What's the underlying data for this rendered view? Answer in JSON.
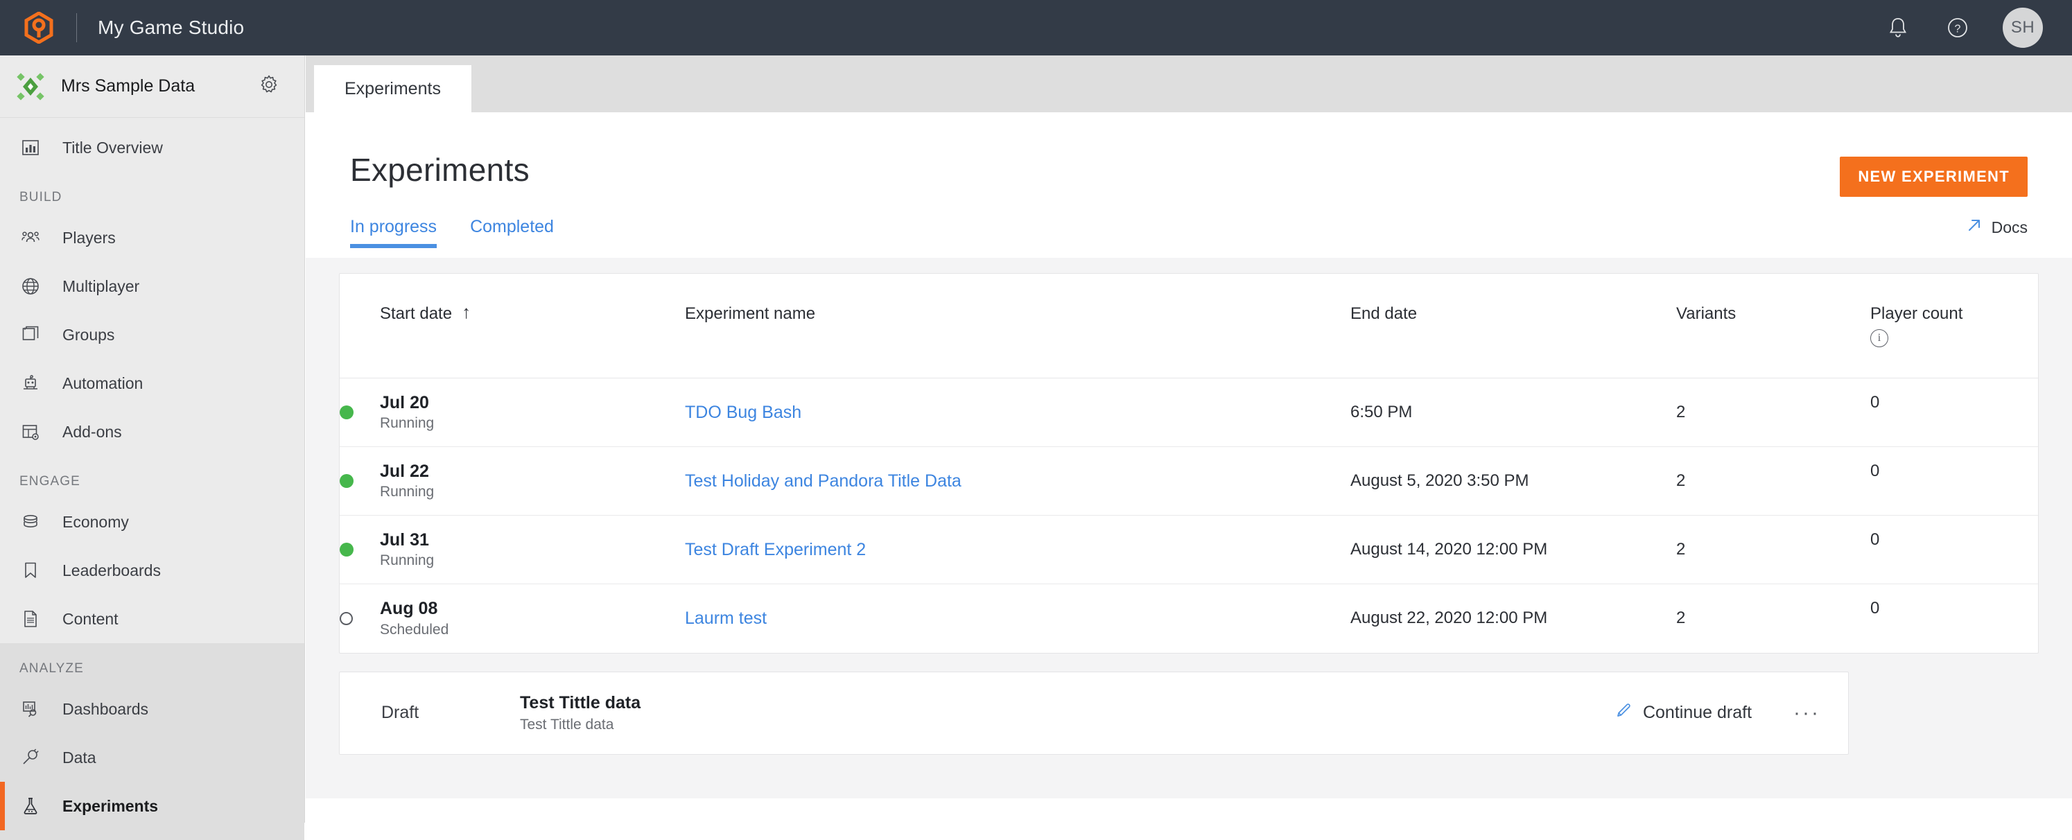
{
  "topbar": {
    "logo_icon": "playfab-hex-logo-icon",
    "title": "My Game Studio",
    "notifications_icon": "bell-icon",
    "help_icon": "help-circle-icon",
    "avatar_initials": "SH"
  },
  "sidebar": {
    "studio": {
      "icon": "green-diamond-title-icon",
      "name": "Mrs Sample Data",
      "settings_icon": "gear-icon"
    },
    "top_items": [
      {
        "label": "Title Overview",
        "icon": "bar-chart-icon",
        "active": false
      }
    ],
    "groups": [
      {
        "label": "BUILD",
        "items": [
          {
            "label": "Players",
            "icon": "players-group-icon",
            "active": false
          },
          {
            "label": "Multiplayer",
            "icon": "globe-icon",
            "active": false
          },
          {
            "label": "Groups",
            "icon": "stacked-squares-icon",
            "active": false
          },
          {
            "label": "Automation",
            "icon": "robot-icon",
            "active": false
          },
          {
            "label": "Add-ons",
            "icon": "table-gear-icon",
            "active": false
          }
        ]
      },
      {
        "label": "ENGAGE",
        "items": [
          {
            "label": "Economy",
            "icon": "coins-stack-icon",
            "active": false
          },
          {
            "label": "Leaderboards",
            "icon": "bookmark-icon",
            "active": false
          },
          {
            "label": "Content",
            "icon": "document-icon",
            "active": false
          }
        ]
      },
      {
        "label": "ANALYZE",
        "items": [
          {
            "label": "Dashboards",
            "icon": "dashboard-search-icon",
            "active": false
          },
          {
            "label": "Data",
            "icon": "plug-icon",
            "active": false
          },
          {
            "label": "Experiments",
            "icon": "flask-icon",
            "active": true
          }
        ]
      }
    ]
  },
  "main": {
    "browser_tab_label": "Experiments",
    "page_title": "Experiments",
    "new_experiment_label": "NEW EXPERIMENT",
    "docs_label": "Docs",
    "docs_icon": "external-link-arrow-icon",
    "subtabs": [
      {
        "label": "In progress",
        "active": true
      },
      {
        "label": "Completed",
        "active": false
      }
    ],
    "table": {
      "columns": [
        {
          "key": "start_date",
          "label": "Start date",
          "sort_icon": "sort-arrow-up-icon"
        },
        {
          "key": "name",
          "label": "Experiment name"
        },
        {
          "key": "end_date",
          "label": "End date"
        },
        {
          "key": "variants",
          "label": "Variants"
        },
        {
          "key": "player_count",
          "label": "Player count",
          "info_icon": "info-circle-icon"
        }
      ],
      "rows": [
        {
          "status": "running",
          "status_label": "Running",
          "start_date": "Jul 20",
          "name": "TDO Bug Bash",
          "end_date": "6:50 PM",
          "variants": "2",
          "player_count": "0"
        },
        {
          "status": "running",
          "status_label": "Running",
          "start_date": "Jul 22",
          "name": "Test Holiday and Pandora Title Data",
          "end_date": "August 5, 2020 3:50 PM",
          "variants": "2",
          "player_count": "0"
        },
        {
          "status": "running",
          "status_label": "Running",
          "start_date": "Jul 31",
          "name": "Test Draft Experiment 2",
          "end_date": "August 14, 2020 12:00 PM",
          "variants": "2",
          "player_count": "0"
        },
        {
          "status": "scheduled",
          "status_label": "Scheduled",
          "start_date": "Aug 08",
          "name": "Laurm test",
          "end_date": "August 22, 2020 12:00 PM",
          "variants": "2",
          "player_count": "0"
        }
      ]
    },
    "draft": {
      "label": "Draft",
      "title": "Test Tittle data",
      "subtitle": "Test Tittle data",
      "continue_label": "Continue draft",
      "edit_icon": "pencil-icon",
      "more_icon": "ellipsis-icon",
      "more_label": "···"
    }
  },
  "colors": {
    "accent_orange": "#f4701d",
    "link_blue": "#3d85e0",
    "running_green": "#46b74c",
    "topbar_dark": "#333b47"
  }
}
